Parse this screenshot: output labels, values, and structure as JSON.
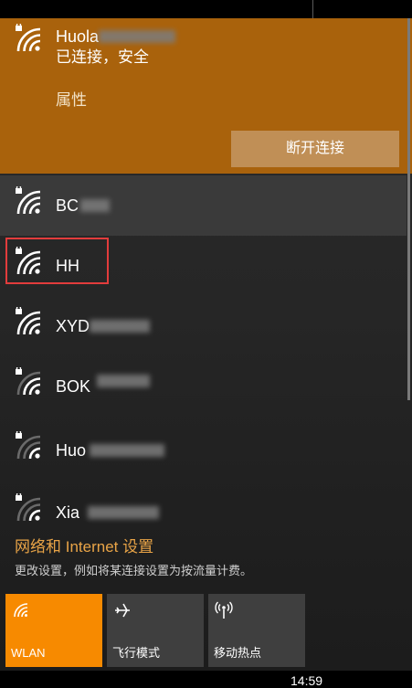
{
  "connected_network": {
    "name": "Huola",
    "status": "已连接，安全",
    "properties_label": "属性",
    "disconnect_label": "断开连接"
  },
  "networks": [
    {
      "name": "BC",
      "secured": true
    },
    {
      "name": "HH",
      "secured": true
    },
    {
      "name": "XYD",
      "secured": true
    },
    {
      "name": "BOK",
      "secured": true
    },
    {
      "name": "Huo",
      "secured": true
    },
    {
      "name": "Xia",
      "secured": true
    }
  ],
  "settings": {
    "link_label": "网络和 Internet 设置",
    "description": "更改设置，例如将某连接设置为按流量计费。"
  },
  "quick_actions": [
    {
      "label": "WLAN",
      "icon": "wifi-icon",
      "active": true
    },
    {
      "label": "飞行模式",
      "icon": "airplane-icon",
      "active": false
    },
    {
      "label": "移动热点",
      "icon": "hotspot-icon",
      "active": false
    }
  ],
  "taskbar": {
    "time": "14:59"
  },
  "colors": {
    "accent": "#f78a00",
    "connected_bg": "#a9620c",
    "highlight": "#e23c3c"
  }
}
